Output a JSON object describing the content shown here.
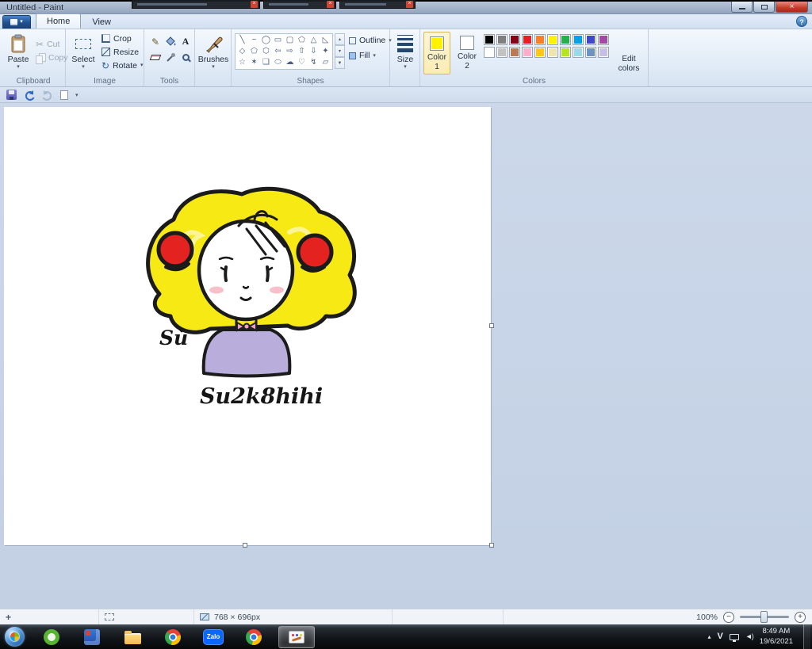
{
  "background_windows": {
    "close_glyph": "×"
  },
  "titlebar": {
    "title": "Untitled - Paint",
    "close_glyph": "×"
  },
  "menubar": {
    "caret": "▾",
    "tabs": [
      {
        "label": "Home"
      },
      {
        "label": "View"
      }
    ],
    "help": "?"
  },
  "ribbon": {
    "clipboard": {
      "caption": "Clipboard",
      "paste": "Paste",
      "cut": "Cut",
      "copy": "Copy",
      "caret": "▾",
      "cut_glyph": "✂"
    },
    "image": {
      "caption": "Image",
      "select": "Select",
      "crop": "Crop",
      "resize": "Resize",
      "rotate": "Rotate",
      "caret": "▾",
      "rotate_glyph": "↻"
    },
    "tools": {
      "caption": "Tools",
      "pencil_glyph": "✎",
      "text_glyph": "A"
    },
    "brushes": {
      "label": "Brushes",
      "caret": "▾"
    },
    "shapes": {
      "caption": "Shapes",
      "glyphs": [
        "╲",
        "~",
        "◯",
        "▭",
        "▢",
        "⬠",
        "△",
        "◺",
        "◇",
        "⬠",
        "⬡",
        "⇦",
        "⇨",
        "⇧",
        "⇩",
        "✦",
        "☆",
        "✶",
        "❏",
        "⬭",
        "☁",
        "♡",
        "↯",
        "▱"
      ],
      "scroll_up": "▴",
      "scroll_down": "▾",
      "scroll_more": "▼",
      "outline": "Outline",
      "fill": "Fill",
      "caret": "▾"
    },
    "size": {
      "label": "Size",
      "caret": "▾"
    },
    "colors_group": {
      "caption": "Colors",
      "color1_label": "Color 1",
      "color2_label": "Color 2",
      "edit_label": "Edit colors",
      "color1": "#fff200",
      "color2": "#ffffff",
      "palette": [
        [
          "#000000",
          "#7f7f7f",
          "#880015",
          "#ed1c24",
          "#ff7f27",
          "#fff200",
          "#22b14c",
          "#00a2e8",
          "#3f48cc",
          "#a349a4"
        ],
        [
          "#ffffff",
          "#c3c3c3",
          "#b97a57",
          "#ffaec9",
          "#ffc90e",
          "#efe4b0",
          "#b5e61d",
          "#99d9ea",
          "#7092be",
          "#c8bfe7"
        ]
      ]
    }
  },
  "qat": {
    "caret": "▾"
  },
  "canvas": {
    "art": {
      "label1": "Sù",
      "label2": "Su2k8hihi",
      "hair": "#f6e914",
      "bun": "#e42320",
      "shirt": "#b9addc",
      "bow": "#f2a2c0",
      "blush": "#f7bfca",
      "skin": "#ffffff",
      "outline": "#1b1b1b"
    }
  },
  "statusbar": {
    "crosshair_glyph": "+",
    "size_text": "768 × 696px",
    "zoom": "100%",
    "zoom_out": "−",
    "zoom_in": "+"
  },
  "taskbar": {
    "apps": [
      {
        "name": "coc-coc",
        "type": "coccoc"
      },
      {
        "name": "app-blue",
        "type": "blueapp"
      },
      {
        "name": "explorer",
        "type": "folder"
      },
      {
        "name": "chrome",
        "type": "chrome"
      },
      {
        "name": "zalo",
        "type": "zalo",
        "label": "Zalo"
      },
      {
        "name": "chrome-2",
        "type": "chrome"
      },
      {
        "name": "paint",
        "type": "paint",
        "active": true
      }
    ],
    "tray": {
      "expand": "▴",
      "unikey": "V",
      "volume": "◄)",
      "clock_time": "8:49 AM",
      "clock_date": "19/6/2021"
    }
  }
}
